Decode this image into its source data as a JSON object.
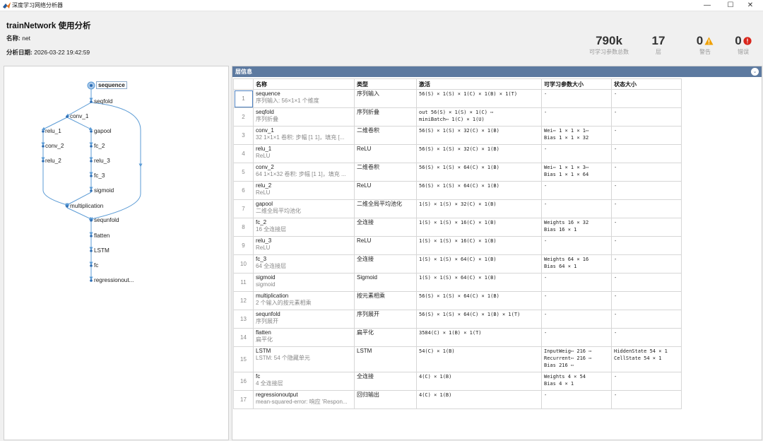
{
  "window": {
    "title": "深度学习网络分析器",
    "minimize": "—",
    "maximize": "☐",
    "close": "✕"
  },
  "header": {
    "title": "trainNetwork 使用分析",
    "name_label": "名称:",
    "name_value": "net",
    "date_label": "分析日期:",
    "date_value": "2026-03-22 19:42:59"
  },
  "stats": [
    {
      "value": "790k",
      "label": "可学习参数总数"
    },
    {
      "value": "17",
      "label": "层"
    },
    {
      "value": "0",
      "label": "警告",
      "icon": "warning-icon",
      "color": "#f0a000"
    },
    {
      "value": "0",
      "label": "错误",
      "icon": "error-icon",
      "color": "#d9261c"
    }
  ],
  "graph": {
    "nodes": [
      {
        "id": "sequence",
        "label": "sequence"
      },
      {
        "id": "seqfold",
        "label": "seqfold"
      },
      {
        "id": "conv_1",
        "label": "conv_1"
      },
      {
        "id": "relu_1",
        "label": "relu_1"
      },
      {
        "id": "gapool",
        "label": "gapool"
      },
      {
        "id": "conv_2",
        "label": "conv_2"
      },
      {
        "id": "fc_2",
        "label": "fc_2"
      },
      {
        "id": "relu_2",
        "label": "relu_2"
      },
      {
        "id": "relu_3",
        "label": "relu_3"
      },
      {
        "id": "fc_3",
        "label": "fc_3"
      },
      {
        "id": "sigmoid",
        "label": "sigmoid"
      },
      {
        "id": "multiplication",
        "label": "multiplication"
      },
      {
        "id": "sequnfold",
        "label": "sequnfold"
      },
      {
        "id": "flatten",
        "label": "flatten"
      },
      {
        "id": "lstm",
        "label": "LSTM"
      },
      {
        "id": "fc",
        "label": "fc"
      },
      {
        "id": "regressionoutput",
        "label": "regressionout..."
      }
    ]
  },
  "info": {
    "title": "层信息",
    "columns": [
      "名称",
      "类型",
      "激活",
      "可学习参数大小",
      "状态大小"
    ],
    "rows": [
      {
        "idx": "1",
        "name": "sequence",
        "desc": "序列输入: 56×1×1 个维度",
        "type": "序列输入",
        "act": [
          "56(S) × 1(S) × 1(C) × 1(B) × 1(T)"
        ],
        "learn": [
          "-"
        ],
        "state": [
          "-"
        ]
      },
      {
        "idx": "2",
        "name": "seqfold",
        "desc": "序列折叠",
        "type": "序列折叠",
        "act": [
          "out        56(S) × 1(S) × 1(C) ⋯",
          "miniBatch⋯  1(C) × 1(U)"
        ],
        "learn": [
          "-"
        ],
        "state": [
          "-"
        ]
      },
      {
        "idx": "3",
        "name": "conv_1",
        "desc": "32 1×1×1 卷积: 步幅 [1 1]，填充 [...",
        "type": "二维卷积",
        "act": [
          "56(S) × 1(S) × 32(C) × 1(B)"
        ],
        "learn": [
          "Wei⋯  1 × 1 × 1⋯",
          "Bias   1 × 1 × 32"
        ],
        "state": [
          "-"
        ]
      },
      {
        "idx": "4",
        "name": "relu_1",
        "desc": "ReLU",
        "type": "ReLU",
        "act": [
          "56(S) × 1(S) × 32(C) × 1(B)"
        ],
        "learn": [
          "-"
        ],
        "state": [
          "-"
        ]
      },
      {
        "idx": "5",
        "name": "conv_2",
        "desc": "64 1×1×32 卷积: 步幅 [1 1]，填充 ...",
        "type": "二维卷积",
        "act": [
          "56(S) × 1(S) × 64(C) × 1(B)"
        ],
        "learn": [
          "Wei⋯  1 × 1 × 3⋯",
          "Bias   1 × 1 × 64"
        ],
        "state": [
          "-"
        ]
      },
      {
        "idx": "6",
        "name": "relu_2",
        "desc": "ReLU",
        "type": "ReLU",
        "act": [
          "56(S) × 1(S) × 64(C) × 1(B)"
        ],
        "learn": [
          "-"
        ],
        "state": [
          "-"
        ]
      },
      {
        "idx": "7",
        "name": "gapool",
        "desc": "二维全局平均池化",
        "type": "二维全局平均池化",
        "act": [
          "1(S) × 1(S) × 32(C) × 1(B)"
        ],
        "learn": [
          "-"
        ],
        "state": [
          "-"
        ]
      },
      {
        "idx": "8",
        "name": "fc_2",
        "desc": "16 全连接层",
        "type": "全连接",
        "act": [
          "1(S) × 1(S) × 16(C) × 1(B)"
        ],
        "learn": [
          "Weights  16 × 32",
          "Bias     16 × 1"
        ],
        "state": [
          "-"
        ]
      },
      {
        "idx": "9",
        "name": "relu_3",
        "desc": "ReLU",
        "type": "ReLU",
        "act": [
          "1(S) × 1(S) × 16(C) × 1(B)"
        ],
        "learn": [
          "-"
        ],
        "state": [
          "-"
        ]
      },
      {
        "idx": "10",
        "name": "fc_3",
        "desc": "64 全连接层",
        "type": "全连接",
        "act": [
          "1(S) × 1(S) × 64(C) × 1(B)"
        ],
        "learn": [
          "Weights  64 × 16",
          "Bias     64 × 1"
        ],
        "state": [
          "-"
        ]
      },
      {
        "idx": "11",
        "name": "sigmoid",
        "desc": "sigmoid",
        "type": "Sigmoid",
        "act": [
          "1(S) × 1(S) × 64(C) × 1(B)"
        ],
        "learn": [
          "-"
        ],
        "state": [
          "-"
        ]
      },
      {
        "idx": "12",
        "name": "multiplication",
        "desc": "2 个输入的按元素相乘",
        "type": "按元素相乘",
        "act": [
          "56(S) × 1(S) × 64(C) × 1(B)"
        ],
        "learn": [
          "-"
        ],
        "state": [
          "-"
        ]
      },
      {
        "idx": "13",
        "name": "sequnfold",
        "desc": "序列展开",
        "type": "序列展开",
        "act": [
          "56(S) × 1(S) × 64(C) × 1(B) × 1(T)"
        ],
        "learn": [
          "-"
        ],
        "state": [
          "-"
        ]
      },
      {
        "idx": "14",
        "name": "flatten",
        "desc": "扁平化",
        "type": "扁平化",
        "act": [
          "3584(C) × 1(B) × 1(T)"
        ],
        "learn": [
          "-"
        ],
        "state": [
          "-"
        ]
      },
      {
        "idx": "15",
        "name": "LSTM",
        "desc": "LSTM: 54 个隐藏单元",
        "type": "LSTM",
        "act": [
          "54(C) × 1(B)"
        ],
        "learn": [
          "InputWeig⋯  216 ⋯",
          "Recurrent⋯  216 ⋯",
          "Bias        216 ⋯"
        ],
        "state": [
          "HiddenState  54 × 1",
          "CellState    54 × 1"
        ]
      },
      {
        "idx": "16",
        "name": "fc",
        "desc": "4 全连接层",
        "type": "全连接",
        "act": [
          "4(C) × 1(B)"
        ],
        "learn": [
          "Weights  4 × 54",
          "Bias     4 × 1"
        ],
        "state": [
          "-"
        ]
      },
      {
        "idx": "17",
        "name": "regressionoutput",
        "desc": "mean-squared-error: 响应 'Respon...",
        "type": "回归输出",
        "act": [
          "4(C) × 1(B)"
        ],
        "learn": [
          "-"
        ],
        "state": [
          "-"
        ]
      }
    ]
  }
}
